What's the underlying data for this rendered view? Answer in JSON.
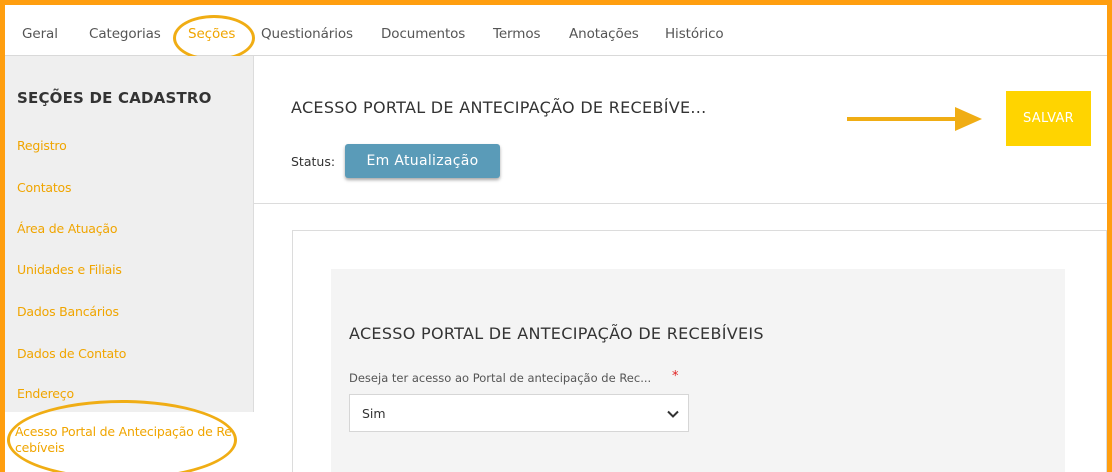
{
  "tabs": [
    {
      "label": "Geral"
    },
    {
      "label": "Categorias"
    },
    {
      "label": "Seções"
    },
    {
      "label": "Questionários"
    },
    {
      "label": "Documentos"
    },
    {
      "label": "Termos"
    },
    {
      "label": "Anotações"
    },
    {
      "label": "Histórico"
    }
  ],
  "active_tab": "Seções",
  "sidebar": {
    "title": "SEÇÕES DE CADASTRO",
    "items": [
      {
        "label": "Registro"
      },
      {
        "label": "Contatos"
      },
      {
        "label": "Área de Atuação"
      },
      {
        "label": "Unidades e Filiais"
      },
      {
        "label": "Dados Bancários"
      },
      {
        "label": "Dados de Contato"
      },
      {
        "label": "Endereço"
      },
      {
        "label": "Acesso Portal de Antecipação de Recebíveis"
      }
    ],
    "active_item": "Acesso Portal de Antecipação de Recebíveis"
  },
  "header": {
    "title": "ACESSO PORTAL DE ANTECIPAÇÃO DE RECEBÍVE...",
    "status_label": "Status:",
    "status_value": "Em Atualização",
    "save_label": "SALVAR"
  },
  "section": {
    "title": "ACESSO PORTAL DE ANTECIPAÇÃO DE RECEBÍVEIS",
    "field_label": "Deseja ter acesso ao Portal de antecipação de Rec...",
    "required_mark": "*",
    "select_value": "Sim"
  },
  "colors": {
    "accent": "#f0a500",
    "annotation": "#f0ad14",
    "save_button": "#ffd400",
    "status_badge": "#5a9bb8"
  }
}
